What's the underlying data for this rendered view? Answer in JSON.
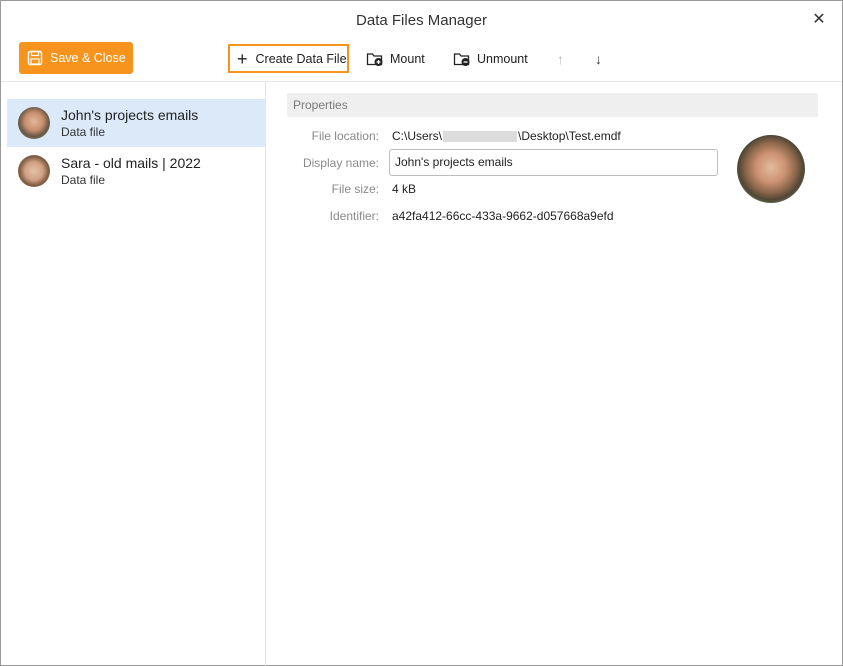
{
  "window": {
    "title": "Data Files Manager",
    "close_glyph": "✕"
  },
  "toolbar": {
    "save_label": "Save & Close",
    "create_label": "Create Data File",
    "mount_label": "Mount",
    "unmount_label": "Unmount",
    "up_glyph": "↑",
    "down_glyph": "↓",
    "accent_color": "#f7941d"
  },
  "sidebar": {
    "items": [
      {
        "name": "John's projects emails",
        "type": "Data file",
        "selected": true
      },
      {
        "name": "Sara - old mails | 2022",
        "type": "Data file",
        "selected": false
      }
    ]
  },
  "properties": {
    "header": "Properties",
    "file_location_label": "File location:",
    "file_location_prefix": "C:\\Users\\",
    "file_location_suffix": "\\Desktop\\Test.emdf",
    "display_name_label": "Display name:",
    "display_name_value": "John's projects emails",
    "file_size_label": "File size:",
    "file_size_value": "4 kB",
    "identifier_label": "Identifier:",
    "identifier_value": "a42fa412-66cc-433a-9662-d057668a9efd"
  }
}
